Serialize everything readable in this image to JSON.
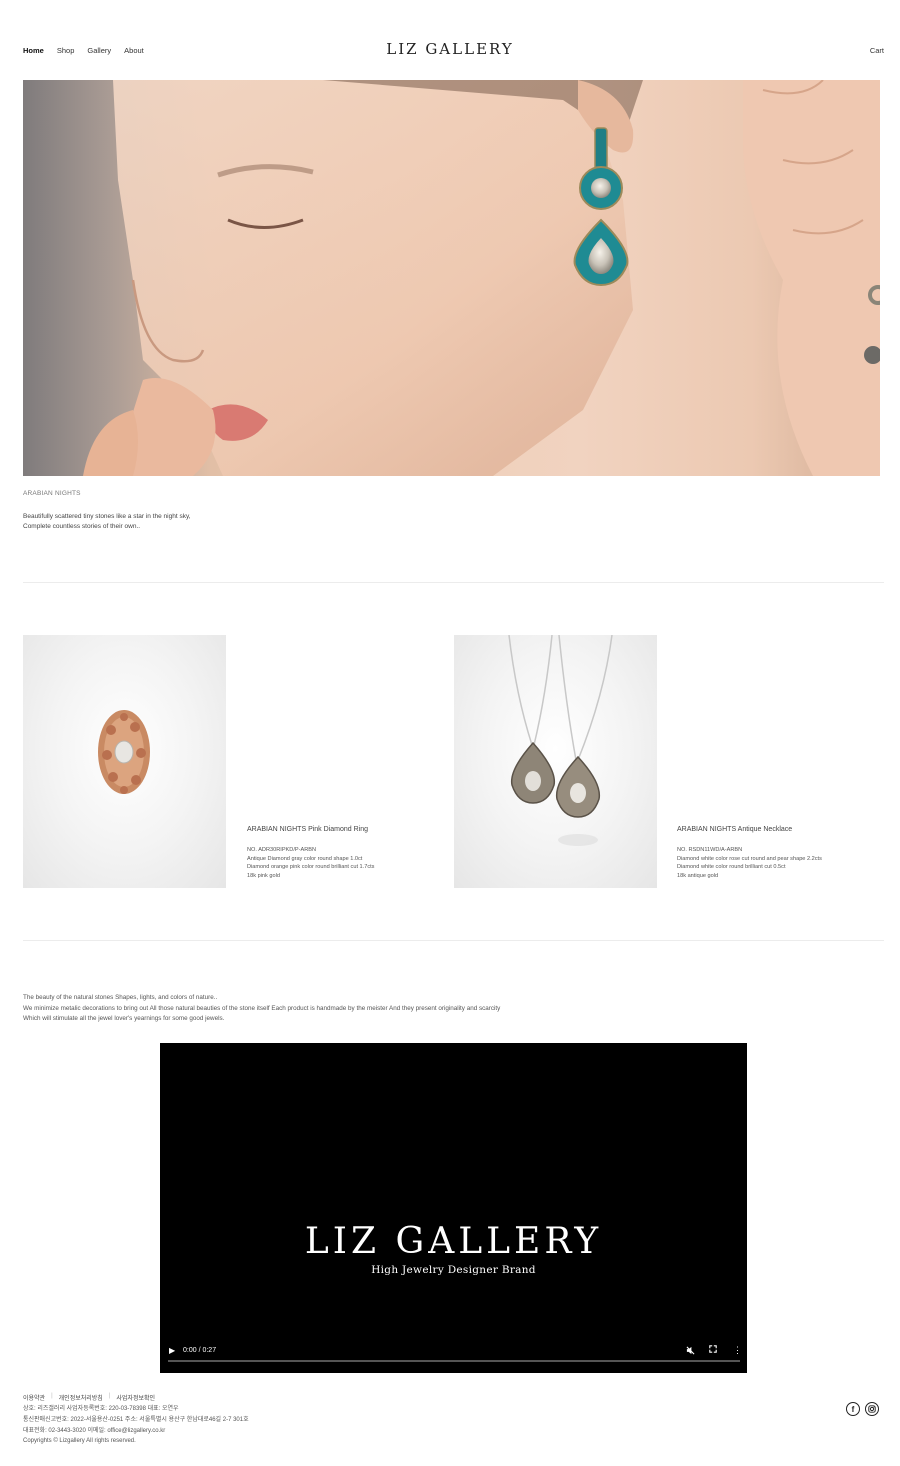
{
  "header": {
    "nav": [
      "Home",
      "Shop",
      "Gallery",
      "About"
    ],
    "logo": "LIZ GALLERY",
    "cart": "Cart"
  },
  "hero": {
    "caption": "ARABIAN NIGHTS",
    "desc_line1": "Beautifully scattered tiny stones like a star in the night sky,",
    "desc_line2": "Complete countless stories of their own.."
  },
  "products": [
    {
      "name": "ARABIAN NIGHTS Pink Diamond Ring",
      "details": [
        "NO. ADR30RIPKD/P-ARBN",
        "Antique Diamond gray color round shape 1.0ct",
        "Diamond orange pink color round brilliant cut 1.7cts",
        "18k pink gold"
      ]
    },
    {
      "name": "ARABIAN NIGHTS Antique Necklace",
      "details": [
        "NO. RSDN11WD/A-ARBN",
        "Diamond white color rose cut round and pear shape 2.2cts",
        "Diamond white color round brilliant cut 0.5ct",
        "18k antique gold"
      ]
    }
  ],
  "story": [
    "The beauty of the natural stones  Shapes, lights, and colors of nature..",
    "We minimize metalic decorations to bring out All those natural beauties of the stone itself Each product is handmade by the meister And they present originality and scarcity",
    "Which will stimulate all the jewel lover's yearnings for some good jewels."
  ],
  "video": {
    "title": "LIZ GALLERY",
    "subtitle": "High Jewelry Designer Brand",
    "time": "0:00 / 0:27",
    "progress": 0
  },
  "footer": {
    "links": [
      "이용약관",
      "개인정보처리방침",
      "사업자정보확인"
    ],
    "info": [
      "상호: 리즈갤러리    사업자등록번호: 220-03-78398    대표: 오연우",
      "통신판매신고번호: 2022-서울용산-0251    주소: 서울특별시 용산구 한남대로46길 2-7 301호",
      "대표전화: 02-3443-3020    이메일: office@lizgallery.co.kr",
      "Copyrights © Lizgallery All rights reserved."
    ],
    "social": [
      "facebook-icon",
      "instagram-icon"
    ]
  },
  "colors": {
    "background": "#ffffff",
    "text": "#333333",
    "video_bg": "#000000",
    "divider": "#ececec"
  }
}
